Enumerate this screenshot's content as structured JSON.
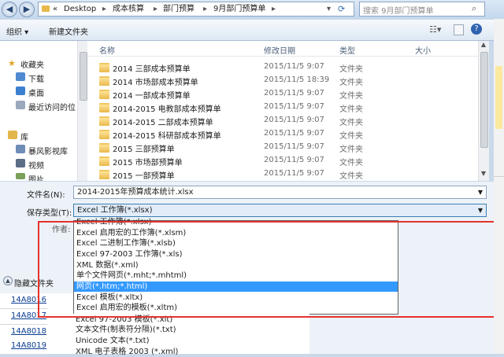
{
  "address": {
    "prefix": "«",
    "crumbs": [
      "Desktop",
      "成本核算",
      "部门预算",
      "9月部门预算单"
    ],
    "separator": "▸",
    "search_placeholder": "搜索 9月部门预算单"
  },
  "toolbar": {
    "organize": "组织 ▾",
    "new_folder": "新建文件夹"
  },
  "sidebar": {
    "favorites": "收藏夹",
    "items": [
      "下载",
      "桌面",
      "最近访问的位"
    ],
    "library": "库",
    "lib_items": [
      "暴风影视库",
      "视频",
      "图片"
    ]
  },
  "columns": {
    "name": "名称",
    "date": "修改日期",
    "type": "类型",
    "size": "大小"
  },
  "files": [
    {
      "name": "2014 三部成本预算单",
      "date": "2015/11/5 9:07",
      "type": "文件夹"
    },
    {
      "name": "2014 市场部成本预算单",
      "date": "2015/11/5 18:39",
      "type": "文件夹"
    },
    {
      "name": "2014 一部成本预算单",
      "date": "2015/11/5 9:07",
      "type": "文件夹"
    },
    {
      "name": "2014-2015 电教部成本预算单",
      "date": "2015/11/5 9:07",
      "type": "文件夹"
    },
    {
      "name": "2014-2015 二部成本预算单",
      "date": "2015/11/5 9:07",
      "type": "文件夹"
    },
    {
      "name": "2014-2015 科研部成本预算单",
      "date": "2015/11/5 9:07",
      "type": "文件夹"
    },
    {
      "name": "2015 三部预算单",
      "date": "2015/11/5 9:07",
      "type": "文件夹"
    },
    {
      "name": "2015 市场部预算单",
      "date": "2015/11/5 9:07",
      "type": "文件夹"
    },
    {
      "name": "2015 一部预算单",
      "date": "2015/11/5 9:07",
      "type": "文件夹"
    }
  ],
  "form": {
    "filename_label": "文件名(N):",
    "filename_value": "2014-2015年预算成本统计.xlsx",
    "type_label": "保存类型(T):",
    "type_value": "Excel 工作簿(*.xlsx)",
    "author_label": "作者:",
    "hide_folders": "隐藏文件夹"
  },
  "type_options": [
    "Excel 工作簿(*.xlsx)",
    "Excel 启用宏的工作簿(*.xlsm)",
    "Excel 二进制工作簿(*.xlsb)",
    "Excel 97-2003 工作簿(*.xls)",
    "XML 数据(*.xml)",
    "单个文件网页(*.mht;*.mhtml)",
    "网页(*.htm;*.html)",
    "Excel 模板(*.xltx)",
    "Excel 启用宏的模板(*.xltm)",
    "Excel 97-2003 模板(*.xlt)",
    "文本文件(制表符分隔)(*.txt)",
    "Unicode 文本(*.txt)",
    "XML 电子表格 2003 (*.xml)"
  ],
  "selected_option": "网页(*.htm;*.html)",
  "sheet_cells": [
    "14A8016",
    "14A8017",
    "14A8018",
    "14A8019"
  ],
  "colors": {
    "highlight_border": "#e5322d",
    "selection": "#3399ff",
    "link": "#0b3d91"
  }
}
